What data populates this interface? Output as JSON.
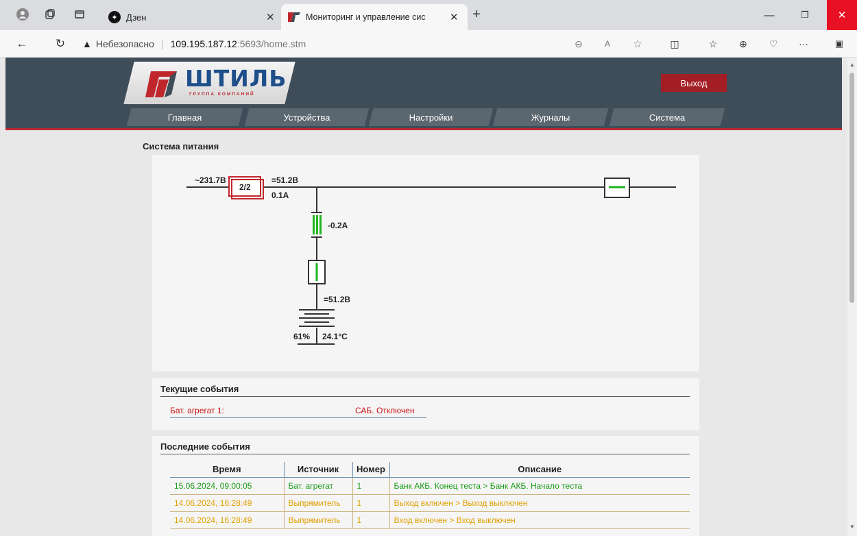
{
  "browser": {
    "tabs": [
      {
        "title": "Дзен"
      },
      {
        "title": "Мониторинг и управление сис"
      }
    ],
    "url_security": "Небезопасно",
    "url_host": "109.195.187.12",
    "url_rest": ":5693/home.stm"
  },
  "header": {
    "logo_text": "ШТИЛЬ",
    "logo_sub": "ГРУППА КОМПАНИЙ",
    "exit_label": "Выход",
    "menu": [
      "Главная",
      "Устройства",
      "Настройки",
      "Журналы",
      "Система"
    ]
  },
  "power": {
    "title": "Система питания",
    "ac_voltage": "~231.7В",
    "rect_count": "2/2",
    "dc_voltage": "=51.2В",
    "load_current": "0.1A",
    "battery_current": "-0.2A",
    "battery_voltage": "=51.2В",
    "battery_charge": "61%",
    "battery_temp": "24.1°C"
  },
  "current_events": {
    "title": "Текущие события",
    "items": [
      {
        "source": "Бат. агрегат 1:",
        "state": "САБ. Отключен"
      }
    ]
  },
  "last_events": {
    "title": "Последние события",
    "headers": [
      "Время",
      "Источник",
      "Номер",
      "Описание"
    ],
    "rows": [
      {
        "time": "15.06.2024, 09:00:05",
        "source": "Бат. агрегат",
        "num": "1",
        "desc": "Банк АКБ. Конец теста > Банк АКБ. Начало теста",
        "color": "#1a9a1a"
      },
      {
        "time": "14.06.2024, 16:28:49",
        "source": "Выпрямитель",
        "num": "1",
        "desc": "Выход включен > Выход выключен",
        "color": "#e0a000"
      },
      {
        "time": "14.06.2024, 16:28:49",
        "source": "Выпрямитель",
        "num": "1",
        "desc": "Вход включен > Вход выключен",
        "color": "#e0a000"
      }
    ]
  },
  "colors": {
    "header_bg": "#3f4d59",
    "accent_red": "#c0272d",
    "event_red": "#cc1111",
    "ok_green": "#1a9a1a",
    "warn_orange": "#e0a000"
  }
}
